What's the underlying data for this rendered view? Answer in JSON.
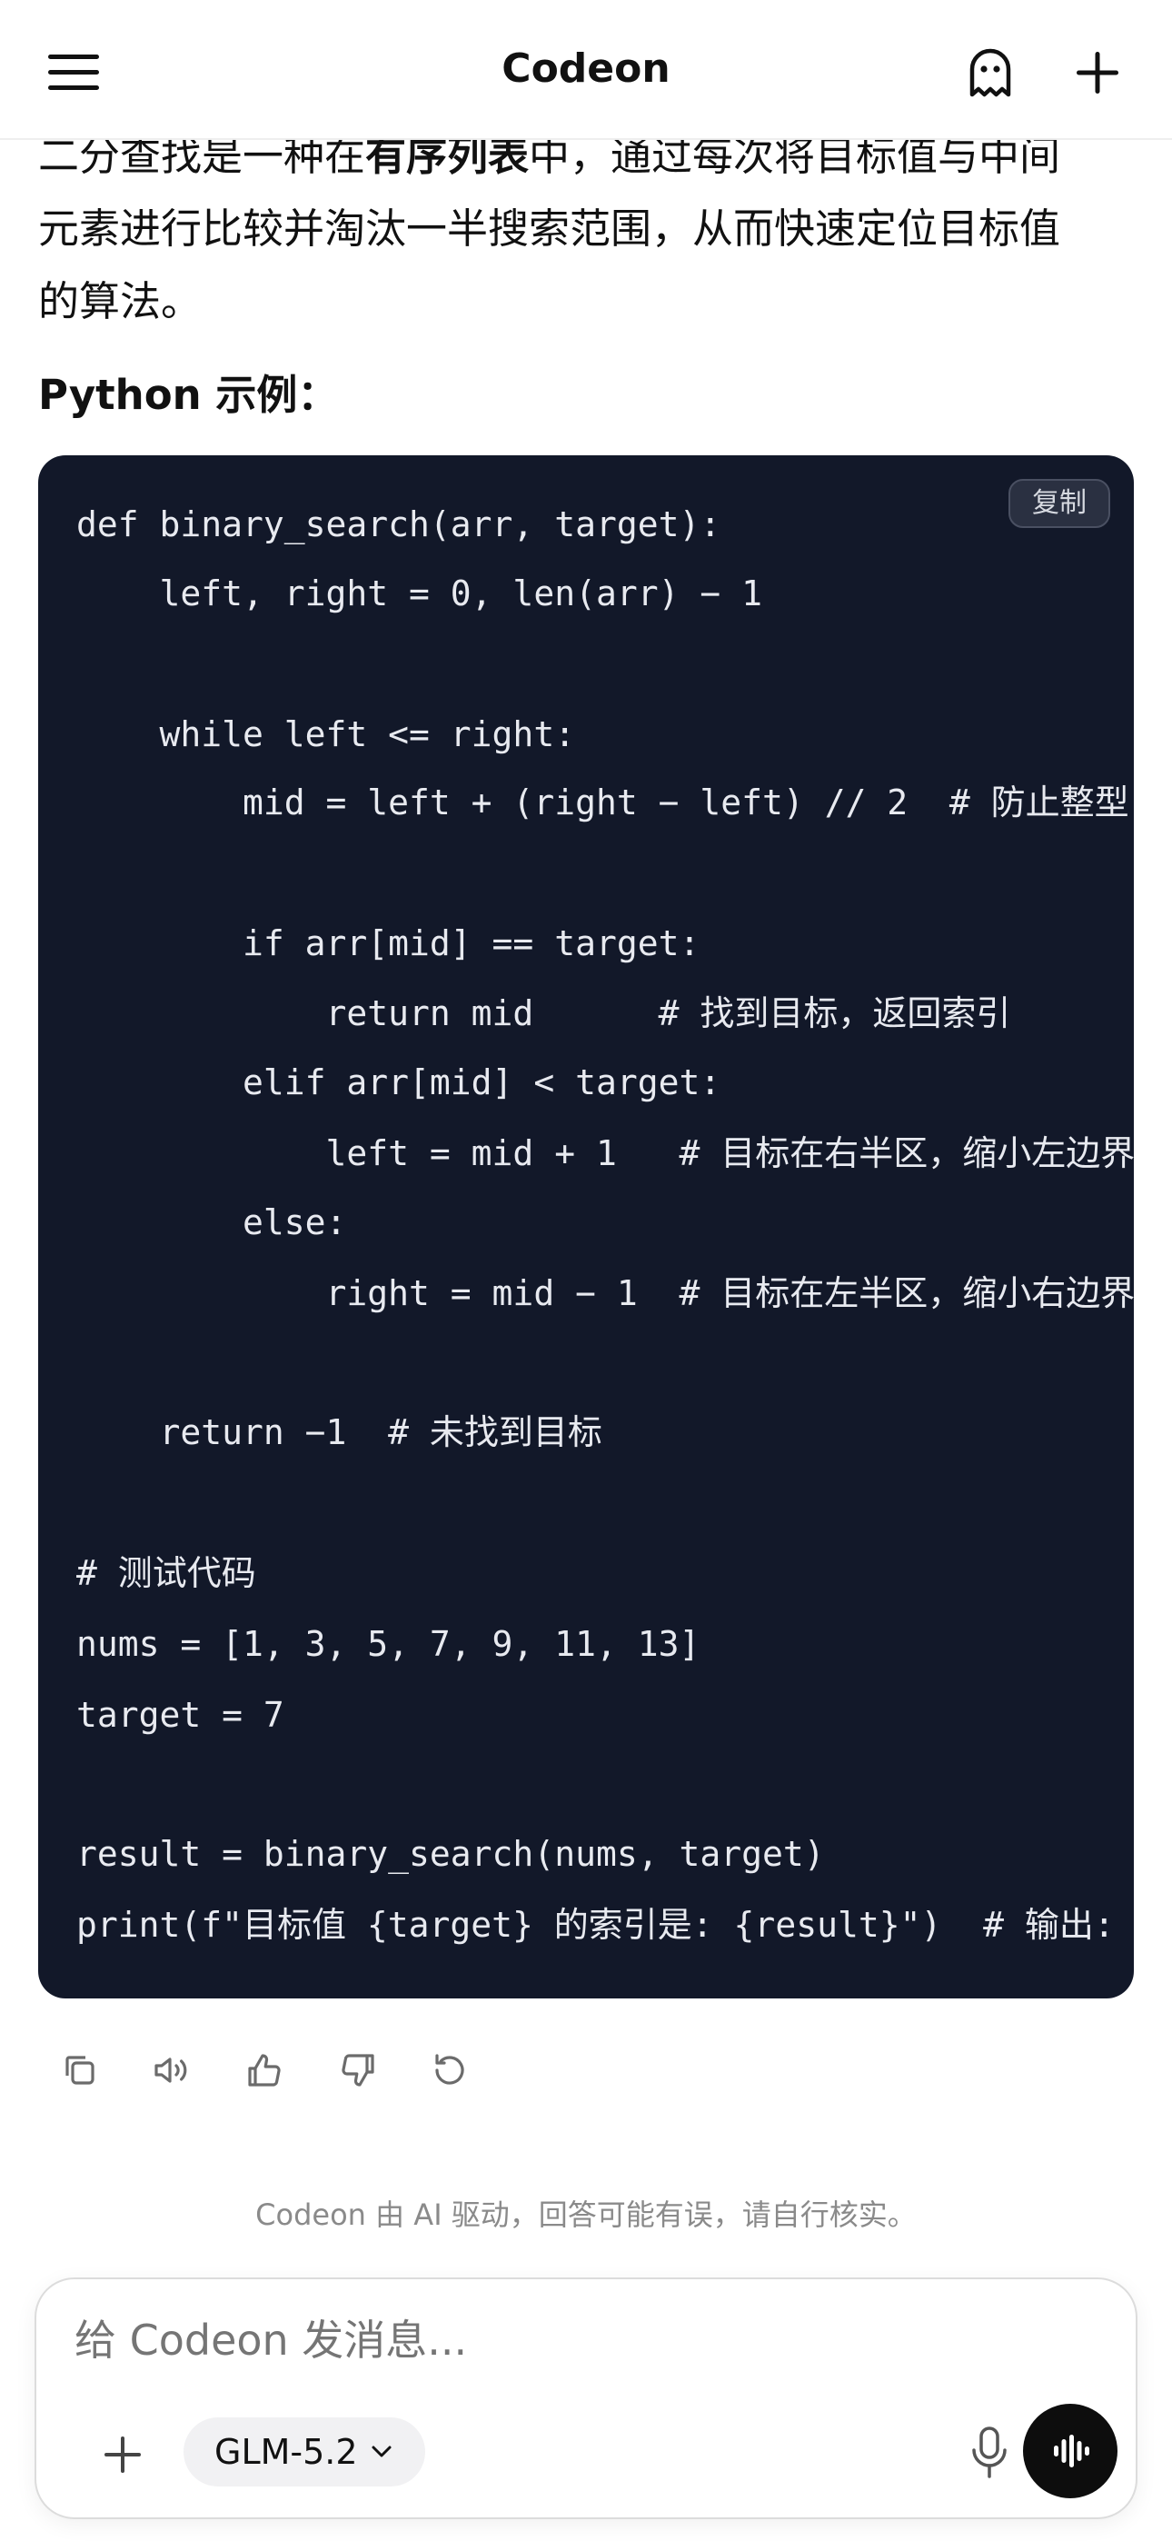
{
  "header": {
    "title": "Codeon",
    "menu_icon": "menu-icon",
    "ghost_icon": "ghost-icon",
    "new_chat_icon": "plus-icon"
  },
  "message": {
    "intro_lines": [
      {
        "before": "二分查找是一种在",
        "bold": "有序列表",
        "after": "中，通过每次将目标值与中间"
      },
      {
        "before": "元素进行比较并淘汰一半搜索范围，从而快速定位目标值",
        "bold": "",
        "after": ""
      },
      {
        "before": "的算法。",
        "bold": "",
        "after": ""
      }
    ],
    "example_heading": "Python 示例：",
    "code": {
      "copy_label": "复制",
      "lines": [
        "def binary_search(arr, target):",
        "    left, right = 0, len(arr) − 1",
        "",
        "    while left <= right:",
        "        mid = left + (right − left) // 2  # 防止整型",
        "",
        "        if arr[mid] == target:",
        "            return mid      # 找到目标，返回索引",
        "        elif arr[mid] < target:",
        "            left = mid + 1   # 目标在右半区，缩小左边界",
        "        else:",
        "            right = mid − 1  # 目标在左半区，缩小右边界",
        "",
        "    return −1  # 未找到目标",
        "",
        "# 测试代码",
        "nums = [1, 3, 5, 7, 9, 11, 13]",
        "target = 7",
        "",
        "result = binary_search(nums, target)",
        "print(f\"目标值 {target} 的索引是: {result}\")  # 输出:"
      ]
    },
    "actions": [
      "copy-icon",
      "speaker-icon",
      "thumbs-up-icon",
      "thumbs-down-icon",
      "regenerate-icon"
    ]
  },
  "disclaimer": "Codeon 由 AI 驱动，回答可能有误，请自行核实。",
  "composer": {
    "placeholder": "给 Codeon 发消息...",
    "model_label": "GLM-5.2",
    "icons": [
      "plus-icon",
      "chevron-down-icon",
      "microphone-icon",
      "voice-waveform-icon"
    ]
  },
  "colors": {
    "code_bg": "#121829",
    "code_text": "#e8eaf0",
    "voice_button": "#0d0d0d",
    "model_pill_bg": "#f1f1f3"
  }
}
